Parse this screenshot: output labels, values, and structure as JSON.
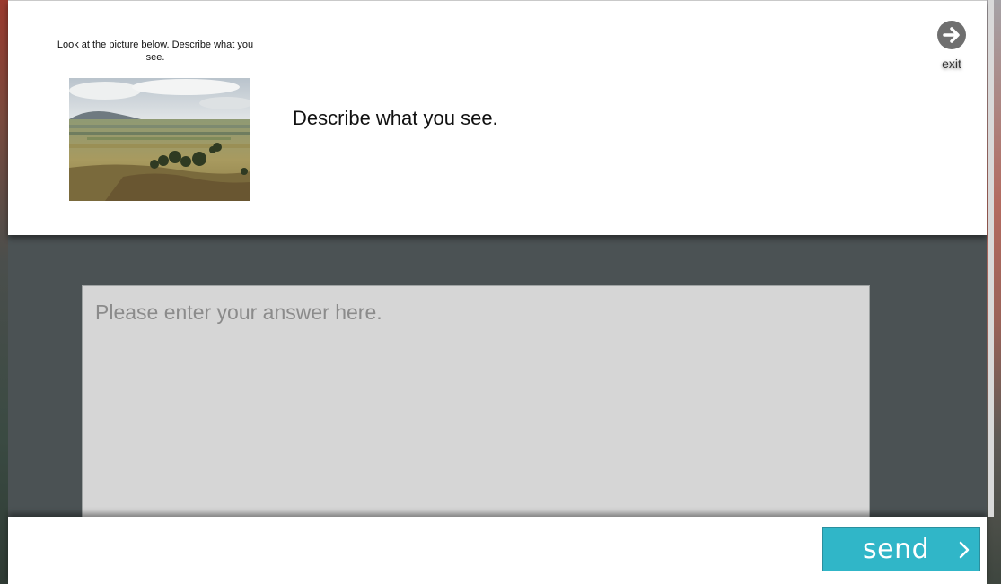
{
  "header": {
    "instruction": "Look at the picture below. Describe what you see.",
    "prompt": "Describe what you see.",
    "exit_label": "exit",
    "exit_icon": "arrow-right-circle-icon"
  },
  "answer": {
    "placeholder": "Please enter your answer here.",
    "value": ""
  },
  "footer": {
    "send_label": "send",
    "send_icon": "chevron-right-icon"
  },
  "colors": {
    "header_bg": "#ffffff",
    "workspace_bg": "#4b5254",
    "answer_bg": "#d6d6d6",
    "send_bg": "#30b6c8",
    "exit_icon_bg": "#6f6f6f"
  }
}
